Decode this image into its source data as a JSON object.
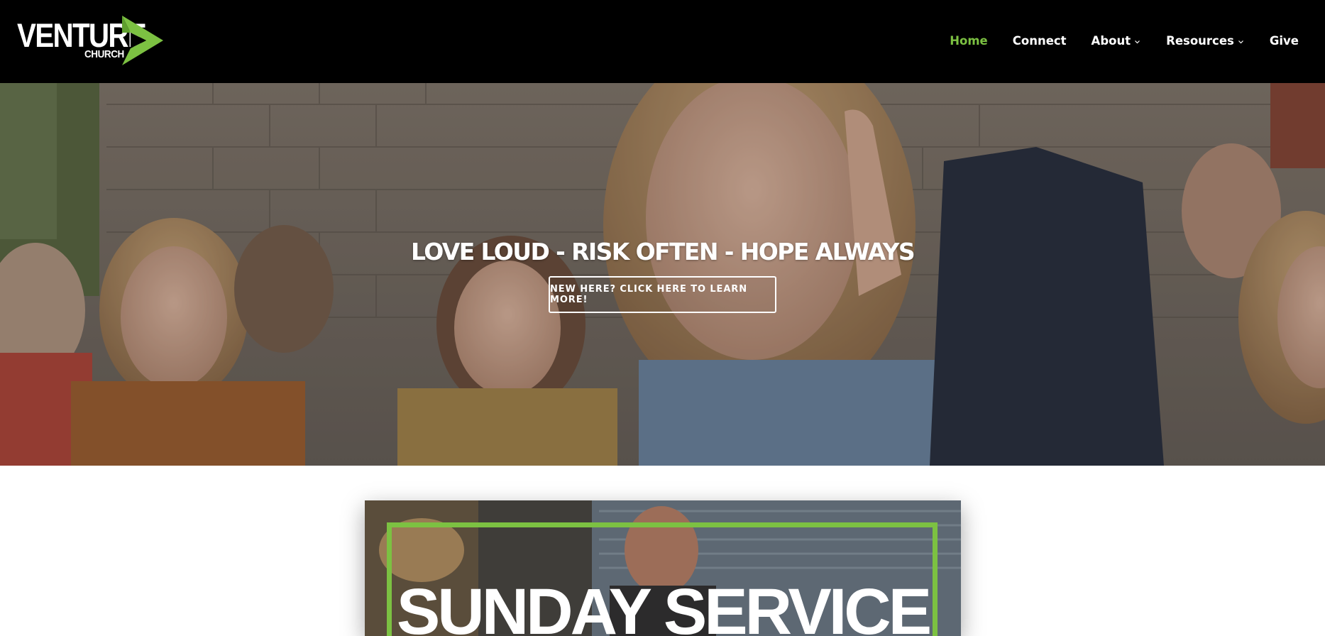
{
  "header": {
    "logo": {
      "wordmark": "VENTURE",
      "subtitle": "CHURCH",
      "icon": "play-triangle-icon",
      "accent_color": "#7cc142"
    },
    "nav": [
      {
        "label": "Home",
        "active": true,
        "has_dropdown": false
      },
      {
        "label": "Connect",
        "active": false,
        "has_dropdown": false
      },
      {
        "label": "About",
        "active": false,
        "has_dropdown": true
      },
      {
        "label": "Resources",
        "active": false,
        "has_dropdown": true
      },
      {
        "label": "Give",
        "active": false,
        "has_dropdown": false
      }
    ]
  },
  "hero": {
    "title": "LOVE LOUD - RISK OFTEN - HOPE ALWAYS",
    "cta_label": "NEW HERE? CLICK HERE TO LEARN MORE!"
  },
  "service": {
    "title": "SUNDAY SERVICE",
    "frame_color": "#7cc142"
  }
}
